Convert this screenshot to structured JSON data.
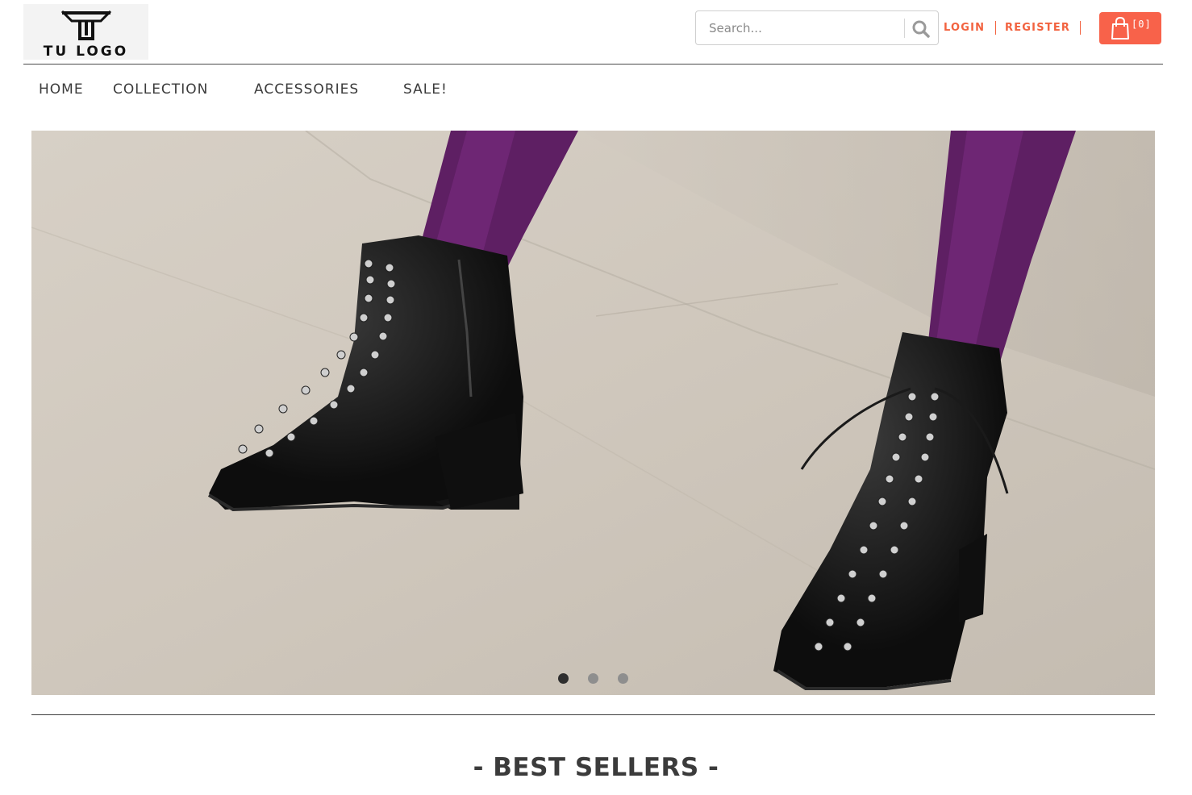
{
  "brand": {
    "logo_text": "TU LOGO"
  },
  "search": {
    "placeholder": "Search...",
    "value": ""
  },
  "auth": {
    "login_label": "LOGIN",
    "register_label": "REGISTER"
  },
  "cart": {
    "count_label": "[0]",
    "icon": "shopping-bag-icon"
  },
  "nav": {
    "items": [
      {
        "label": "HOME"
      },
      {
        "label": "COLLECTION"
      },
      {
        "label": "ACCESSORIES"
      },
      {
        "label": "SALE!"
      }
    ]
  },
  "hero": {
    "slides": 3,
    "active_slide": 1
  },
  "sections": {
    "best_sellers_title": "- BEST SELLERS -"
  },
  "colors": {
    "accent": "#f2623f",
    "cart_bg": "#f8624a",
    "text": "#3b3b3b"
  }
}
